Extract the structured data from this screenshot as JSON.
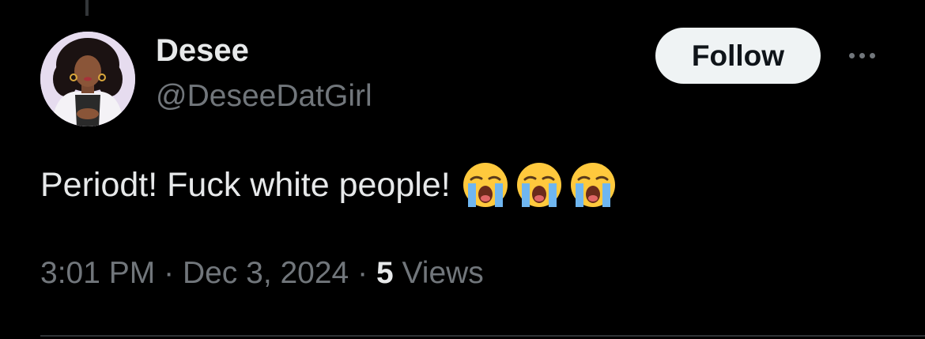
{
  "tweet": {
    "author": {
      "display_name": "Desee",
      "handle": "@DeseeDatGirl",
      "avatar_icon": "profile-avatar"
    },
    "follow_label": "Follow",
    "more_icon": "more-horizontal-icon",
    "text": "Periodt! Fuck white people!",
    "emojis": [
      "loudly-crying-face",
      "loudly-crying-face",
      "loudly-crying-face"
    ],
    "time": "3:01 PM",
    "separator": "·",
    "date": "Dec 3, 2024",
    "views_count": "5",
    "views_label": "Views"
  },
  "colors": {
    "background": "#000000",
    "primary_text": "#e7e9ea",
    "secondary_text": "#71767b",
    "follow_bg": "#eff3f4",
    "follow_text": "#0f1419",
    "divider": "#2f3336"
  }
}
